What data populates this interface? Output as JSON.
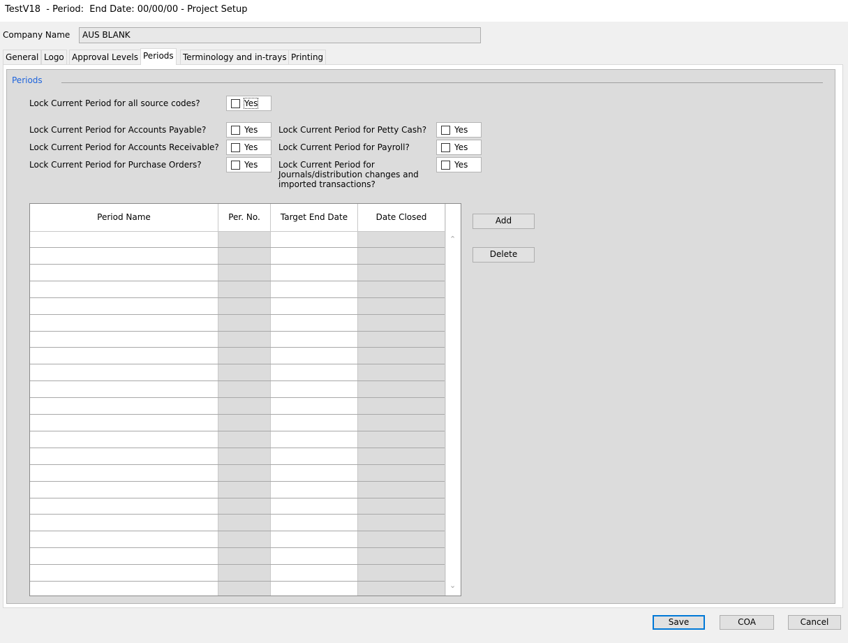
{
  "window": {
    "title": "TestV18  - Period:  End Date: 00/00/00 - Project Setup"
  },
  "company": {
    "label": "Company Name",
    "value": "AUS BLANK"
  },
  "tabs": [
    {
      "label": "General"
    },
    {
      "label": "Logo"
    },
    {
      "label": "Approval Levels"
    },
    {
      "label": "Periods",
      "active": true
    },
    {
      "label": "Terminology and in-trays"
    },
    {
      "label": "Printing"
    }
  ],
  "periods": {
    "group_title": "Periods",
    "lock_all": {
      "question": "Lock Current Period for all source codes?",
      "option": "Yes",
      "checked": false
    },
    "lock_ap": {
      "question": "Lock Current Period for Accounts Payable?",
      "option": "Yes",
      "checked": false
    },
    "lock_ar": {
      "question": "Lock Current Period for Accounts Receivable?",
      "option": "Yes",
      "checked": false
    },
    "lock_po": {
      "question": "Lock Current Period for Purchase Orders?",
      "option": "Yes",
      "checked": false
    },
    "lock_petty": {
      "question": "Lock Current Period for Petty Cash?",
      "option": "Yes",
      "checked": false
    },
    "lock_payroll": {
      "question": "Lock Current Period for Payroll?",
      "option": "Yes",
      "checked": false
    },
    "lock_journals": {
      "question_line1": "Lock Current Period for",
      "question_line2": "Journals/distribution changes and",
      "question_line3": "imported transactions?",
      "option": "Yes",
      "checked": false
    },
    "grid": {
      "columns": [
        "Period Name",
        "Per. No.",
        "Target End Date",
        "Date Closed"
      ],
      "rows": []
    },
    "buttons": {
      "add": "Add",
      "delete": "Delete"
    }
  },
  "footer": {
    "save": "Save",
    "coa": "COA",
    "cancel": "Cancel"
  },
  "icons": {
    "scroll_up": "chevron-up-icon",
    "scroll_down": "chevron-down-icon"
  }
}
